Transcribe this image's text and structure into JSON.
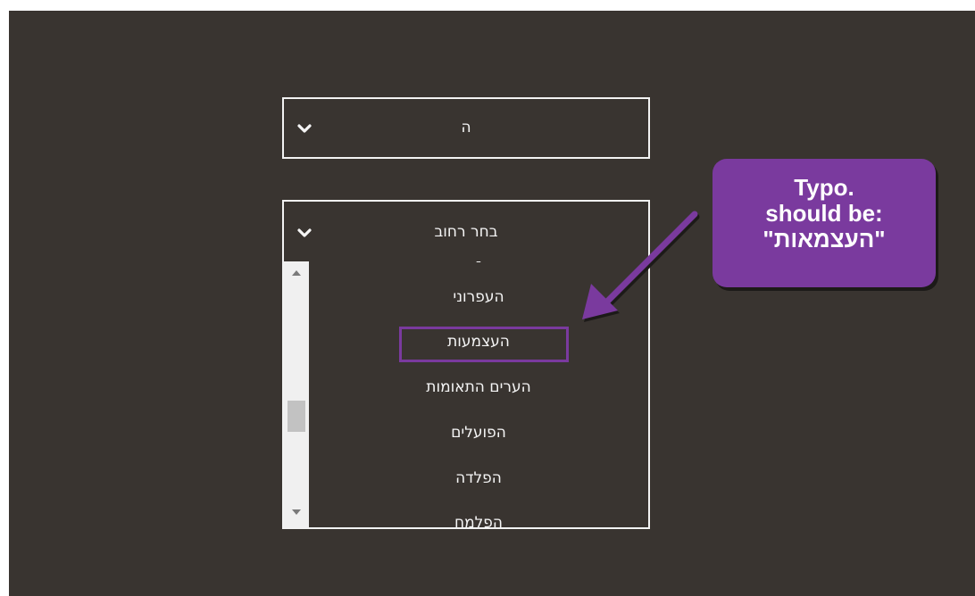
{
  "colors": {
    "panel_bg": "#393430",
    "accent_purple": "#7a3a9e",
    "text_light": "#f5f5f5",
    "scrollbar_track": "#f0f0f0",
    "scrollbar_thumb": "#c2c2c2"
  },
  "select_top": {
    "value": "ה",
    "icon": "chevron-down-icon"
  },
  "select_street": {
    "placeholder": "בחר רחוב",
    "icon": "chevron-down-icon"
  },
  "dropdown": {
    "partial_top_item": "-",
    "items": [
      "העפרוני",
      "העצמעות",
      "הערים התאומות",
      "הפועלים",
      "הפלדה",
      "הפלמח"
    ],
    "highlighted_item": "העצמעות"
  },
  "annotation": {
    "line1": "Typo.",
    "line2": "should be:",
    "line3": "\"העצמאות\""
  }
}
